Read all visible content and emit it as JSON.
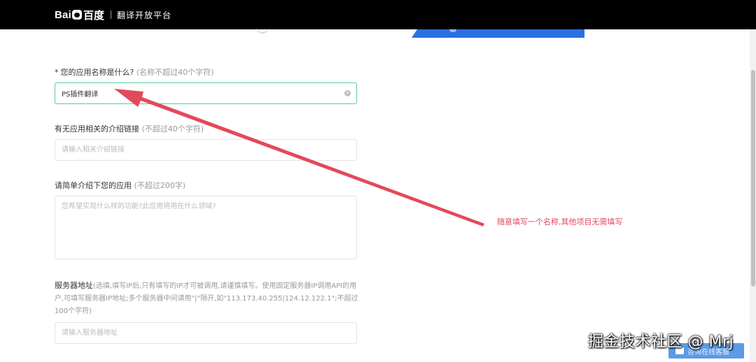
{
  "header": {
    "logo_bai": "Bai",
    "logo_du": "百度",
    "platform_name": "翻译开放平台"
  },
  "form": {
    "app_name": {
      "label": "您的应用名称是什么?",
      "required_mark": "*",
      "hint": "(名称不超过40个字符)",
      "value": "PS插件翻译"
    },
    "intro_link": {
      "label": "有无应用相关的介绍链接",
      "hint": "(不超过40个字符)",
      "placeholder": "请输入相关介绍链接"
    },
    "app_desc": {
      "label": "请简单介绍下您的应用",
      "hint": "(不超过200字)",
      "placeholder": "您希望实现什么样的功能?此应用将用在什么领域?"
    },
    "server_addr": {
      "label": "服务器地址",
      "hint": "(选填,填写IP后,只有填写的IP才可被调用,请谨慎填写。使用固定服务器IP调用API的用户,可填写服务器IP地址;多个服务器中间请用\"|\"隔开,如\"113.173.40.255|124.12.122.1\";不超过100个字符)",
      "placeholder": "请输入服务器地址"
    }
  },
  "annotation": {
    "text": "随意填写一个名称,其他项目无需填写",
    "color": "#e24a5a"
  },
  "watermark": "掘金技术社区 @ Mrj",
  "online_service": {
    "label": "咨询在线客服"
  },
  "colors": {
    "header_bg": "#000000",
    "active_border": "#59c9a5",
    "step_blue": "#2b6fe0"
  }
}
